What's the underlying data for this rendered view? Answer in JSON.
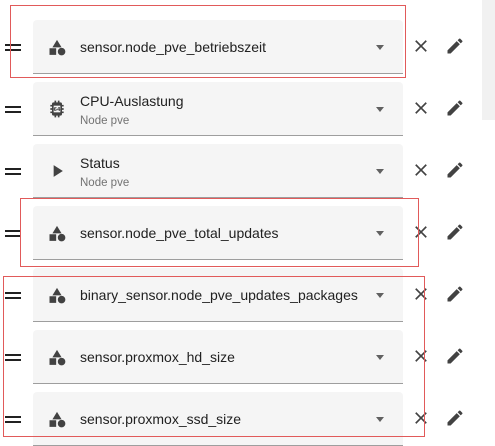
{
  "entities": [
    {
      "primary": "sensor.node_pve_betriebszeit",
      "secondary": "",
      "icon": "shapes-icon"
    },
    {
      "primary": "CPU-Auslastung",
      "secondary": "Node pve",
      "icon": "cpu-chip-icon"
    },
    {
      "primary": "Status",
      "secondary": "Node pve",
      "icon": "play-icon"
    },
    {
      "primary": "sensor.node_pve_total_updates",
      "secondary": "",
      "icon": "shapes-icon"
    },
    {
      "primary": "binary_sensor.node_pve_updates_packages",
      "secondary": "",
      "icon": "shapes-icon"
    },
    {
      "primary": "sensor.proxmox_hd_size",
      "secondary": "",
      "icon": "shapes-icon"
    },
    {
      "primary": "sensor.proxmox_ssd_size",
      "secondary": "",
      "icon": "shapes-icon"
    }
  ],
  "colors": {
    "highlight": "#e15a5a",
    "field_bg": "#f5f5f5",
    "icon": "#424242"
  }
}
